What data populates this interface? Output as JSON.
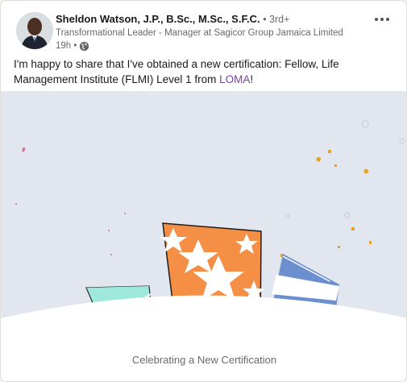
{
  "post": {
    "author": {
      "name": "Sheldon Watson, J.P., B.Sc., M.Sc., S.F.C.",
      "degree": "• 3rd+",
      "headline": "Transformational Leader - Manager at Sagicor Group Jamaica Limited",
      "time": "19h •",
      "visibility_icon": "globe-icon"
    },
    "more_icon": "ellipsis-icon",
    "text_prefix": "I'm happy to share that I've obtained a new certification: Fellow, Life Management Institute (FLMI) Level 1 from ",
    "text_link": "LOMA",
    "text_suffix": "!",
    "media": {
      "caption": "Celebrating a New Certification"
    }
  },
  "colors": {
    "link": "#7a3e9d",
    "media_bg": "#e2e6ee",
    "orange": "#f58f45",
    "mint": "#9fe8dc",
    "blue": "#6b8fcf",
    "confetti": "#e3a32b"
  }
}
